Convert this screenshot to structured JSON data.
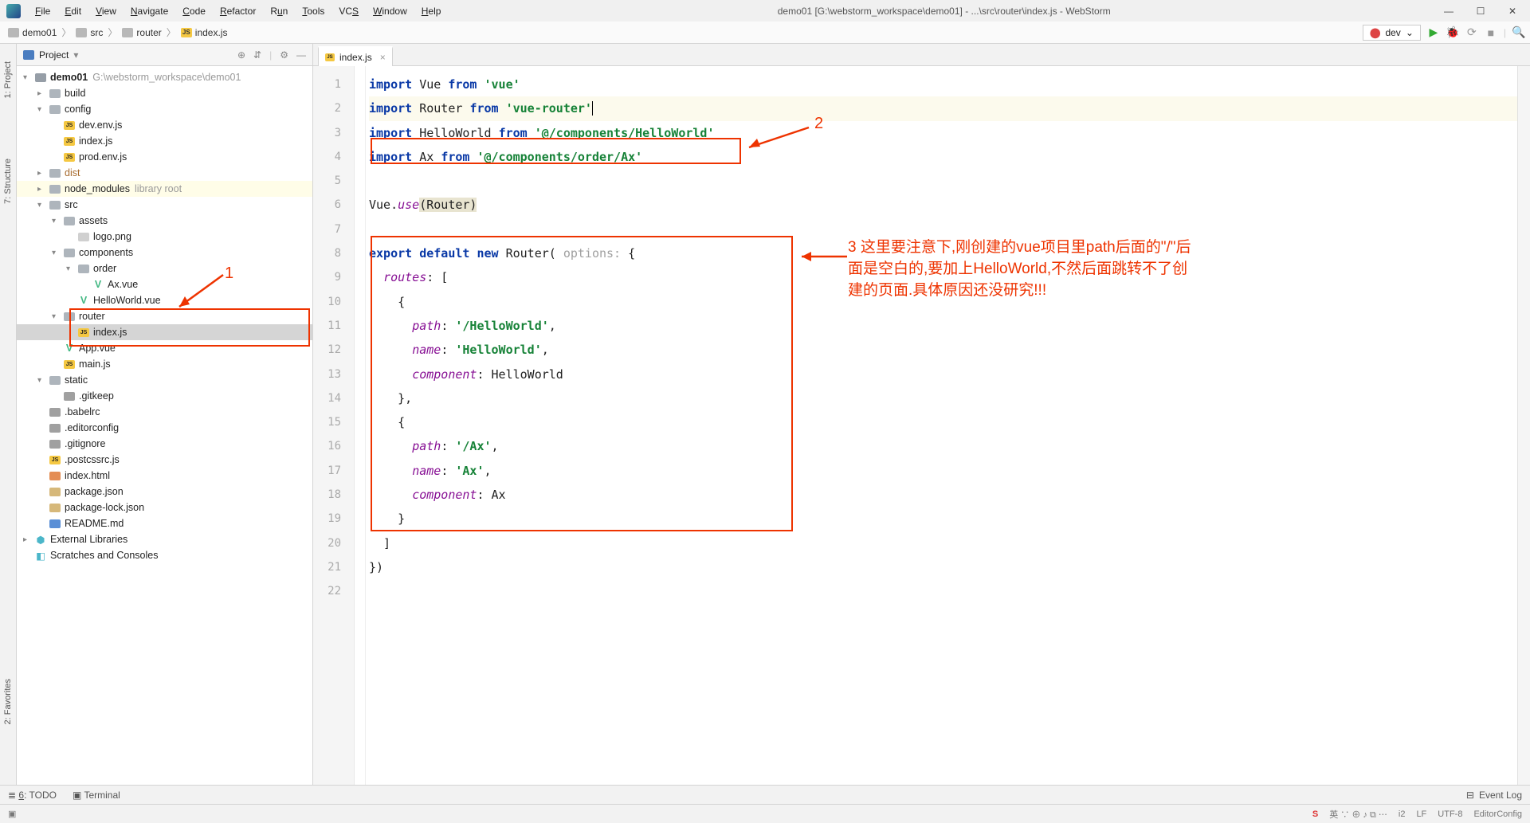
{
  "menus": [
    "File",
    "Edit",
    "View",
    "Navigate",
    "Code",
    "Refactor",
    "Run",
    "Tools",
    "VCS",
    "Window",
    "Help"
  ],
  "title": "demo01 [G:\\webstorm_workspace\\demo01] - ...\\src\\router\\index.js - WebStorm",
  "breadcrumbs": [
    "demo01",
    "src",
    "router",
    "index.js"
  ],
  "run_config": "dev",
  "sidebar_title": "Project",
  "vtabs": {
    "project": "1: Project",
    "structure": "7: Structure",
    "favorites": "2: Favorites"
  },
  "tree": {
    "root": "demo01",
    "root_path": "G:\\webstorm_workspace\\demo01",
    "build": "build",
    "config": "config",
    "config_files": [
      "dev.env.js",
      "index.js",
      "prod.env.js"
    ],
    "dist": "dist",
    "node_modules": "node_modules",
    "node_modules_note": "library root",
    "src": "src",
    "assets": "assets",
    "logo": "logo.png",
    "components": "components",
    "order": "order",
    "ax": "Ax.vue",
    "hello": "HelloWorld.vue",
    "router": "router",
    "router_index": "index.js",
    "appvue": "App.vue",
    "mainjs": "main.js",
    "static": "static",
    "gitkeep": ".gitkeep",
    "rootfiles": [
      ".babelrc",
      ".editorconfig",
      ".gitignore",
      ".postcssrc.js",
      "index.html",
      "package.json",
      "package-lock.json",
      "README.md"
    ],
    "ext_lib": "External Libraries",
    "scratch": "Scratches and Consoles"
  },
  "tab": "index.js",
  "code": {
    "l1": {
      "a": "import",
      "b": " Vue ",
      "c": "from",
      "d": " ",
      "e": "'vue'"
    },
    "l2": {
      "a": "import",
      "b": " Router ",
      "c": "from",
      "d": " ",
      "e": "'vue-router'"
    },
    "l3": {
      "a": "import",
      "b": " HelloWorld ",
      "c": "from",
      "d": " ",
      "e": "'@/components/HelloWorld'"
    },
    "l4": {
      "a": "import",
      "b": " Ax ",
      "c": "from",
      "d": " ",
      "e": "'@/components/order/Ax'"
    },
    "l6": {
      "a": "Vue.",
      "b": "use",
      "c": "(Router)"
    },
    "l8": {
      "a": "export default new",
      "b": " Router(",
      "h": " options: ",
      "c": "{"
    },
    "l9": {
      "a": "  ",
      "b": "routes",
      "c": ": ["
    },
    "l10": "    {",
    "l11": {
      "a": "      ",
      "b": "path",
      "c": ": ",
      "d": "'/HelloWorld'",
      "e": ","
    },
    "l12": {
      "a": "      ",
      "b": "name",
      "c": ": ",
      "d": "'HelloWorld'",
      "e": ","
    },
    "l13": {
      "a": "      ",
      "b": "component",
      "c": ": HelloWorld"
    },
    "l14": "    },",
    "l15": "    {",
    "l16": {
      "a": "      ",
      "b": "path",
      "c": ": ",
      "d": "'/Ax'",
      "e": ","
    },
    "l17": {
      "a": "      ",
      "b": "name",
      "c": ": ",
      "d": "'Ax'",
      "e": ","
    },
    "l18": {
      "a": "      ",
      "b": "component",
      "c": ": Ax"
    },
    "l19": "    }",
    "l20": "  ]",
    "l21": "})"
  },
  "annotations": {
    "n1": "1",
    "n2": "2",
    "n3": "3  这里要注意下,刚创建的vue项目里path后面的\"/\"后面是空白的,要加上HelloWorld,不然后面跳转不了创建的页面.具体原因还没研究!!!"
  },
  "bottom": {
    "todo": "6: TODO",
    "terminal": "Terminal",
    "eventlog": "Event Log"
  },
  "status": {
    "pos": "i2",
    "lf": "LF",
    "enc": "UTF-8",
    "ec": "EditorConfig"
  }
}
